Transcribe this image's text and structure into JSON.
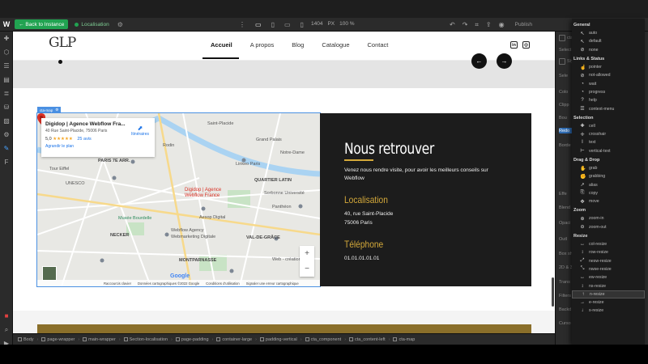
{
  "topbar": {
    "back_label": "Back to Instance",
    "page_name": "Localisation",
    "canvas_width": "1404",
    "canvas_unit": "PX",
    "zoom": "100 %",
    "publish_label": "Publish"
  },
  "site": {
    "logo_text": "GLP",
    "nav": [
      {
        "label": "Accueil"
      },
      {
        "label": "A propos"
      },
      {
        "label": "Blog"
      },
      {
        "label": "Catalogue"
      },
      {
        "label": "Contact"
      }
    ],
    "social": [
      "in",
      "◎"
    ]
  },
  "slider": {
    "prev": "←",
    "next": "→"
  },
  "selection_tag": "cta-map",
  "map": {
    "card": {
      "title": "Digidop | Agence Webflow Fra...",
      "address": "40 Rue Saint-Placide, 75006 Paris",
      "rating": "5,0",
      "stars": "★★★★★",
      "reviews": "25 avis",
      "more": "Agrandir le plan",
      "directions": "Itinéraires"
    },
    "labels": [
      {
        "text": "PARIS 7E ARR.",
        "kind": "strong"
      },
      {
        "text": "Tour Eiffel",
        "kind": "normal"
      },
      {
        "text": "Rodin",
        "kind": "normal"
      },
      {
        "text": "Saint-Placide",
        "kind": "normal"
      },
      {
        "text": "Linkeo Paris",
        "kind": "normal"
      },
      {
        "text": "QUARTIER LATIN",
        "kind": "strong"
      },
      {
        "text": "Panthéon",
        "kind": "normal"
      },
      {
        "text": "UNESCO",
        "kind": "normal"
      },
      {
        "text": "Musée Bourdelle",
        "kind": "green"
      },
      {
        "text": "Aesop Digital",
        "kind": "normal"
      },
      {
        "text": "Webflow Agency",
        "kind": "normal"
      },
      {
        "text": "Webmarketing Digitale",
        "kind": "normal"
      },
      {
        "text": "NECKER",
        "kind": "strong"
      },
      {
        "text": "VAL-DE-GRÂCE",
        "kind": "strong"
      },
      {
        "text": "MONTPARNASSE",
        "kind": "strong"
      },
      {
        "text": "Sorbonne Université",
        "kind": "normal"
      },
      {
        "text": "Web - création site",
        "kind": "normal"
      },
      {
        "text": "Notre-Dame",
        "kind": "normal"
      },
      {
        "text": "Grand Palais",
        "kind": "normal"
      }
    ],
    "pin_label": "Digidop | Agence",
    "pin_label2": "Webflow France",
    "zoom_in": "+",
    "zoom_out": "−",
    "google": "Google",
    "footer": [
      "Raccourcis clavier",
      "Données cartographiques ©2022 Google",
      "Conditions d'utilisation",
      "Signaler une erreur cartographique"
    ]
  },
  "contact": {
    "heading": "Nous retrouver",
    "intro": "Venez nous rendre visite, pour avoir les meilleurs conseils sur Webflow",
    "loc_title": "Localisation",
    "address_line1": "40, rue Saint-Placide",
    "address_line2": "75006 Paris",
    "phone_title": "Téléphone",
    "phone": "01.01.01.01.01"
  },
  "breadcrumb": [
    "Body",
    "page-wrapper",
    "main-wrapper",
    "Section-localisation",
    "page-padding",
    "container-large",
    "padding-vertical",
    "cta_component",
    "cta_content-left",
    "cta-map"
  ],
  "right_panel": {
    "labels": [
      "cta",
      "Select",
      "Style",
      "Sele",
      "Colo",
      "Clipp",
      "Bou",
      "Redo",
      "Borde",
      "Effe",
      "Blend",
      "Opaci",
      "Outl",
      "Box sh",
      "2D & 3",
      "Trans",
      "Filters",
      "Backd",
      "Curso"
    ]
  },
  "cursor_menu": {
    "groups": [
      {
        "heading": "General",
        "items": [
          "auto",
          "default",
          "none"
        ]
      },
      {
        "heading": "Links & Status",
        "items": [
          "pointer",
          "not-allowed",
          "wait",
          "progress",
          "help",
          "context-menu"
        ]
      },
      {
        "heading": "Selection",
        "items": [
          "cell",
          "crosshair",
          "text",
          "vertical-text"
        ]
      },
      {
        "heading": "Drag & Drop",
        "items": [
          "grab",
          "grabbing",
          "alias",
          "copy",
          "move"
        ]
      },
      {
        "heading": "Zoom",
        "items": [
          "zoom-in",
          "zoom-out"
        ]
      },
      {
        "heading": "Resize",
        "items": [
          "col-resize",
          "row-resize",
          "nesw-resize",
          "nwse-resize",
          "ew-resize",
          "ns-resize",
          "n-resize",
          "e-resize",
          "s-resize"
        ]
      }
    ],
    "selected": "n-resize",
    "icons": [
      "↖",
      "↖",
      "⊘",
      "☝",
      "⊘",
      "◔",
      "◔",
      "?",
      "☰",
      "✚",
      "✛",
      "I",
      "⊢",
      "✋",
      "✊",
      "↗",
      "⎘",
      "✥",
      "⊕",
      "⊖",
      "↔",
      "↕",
      "⤢",
      "⤡",
      "↔",
      "↕",
      "↑",
      "→",
      "↓"
    ]
  }
}
